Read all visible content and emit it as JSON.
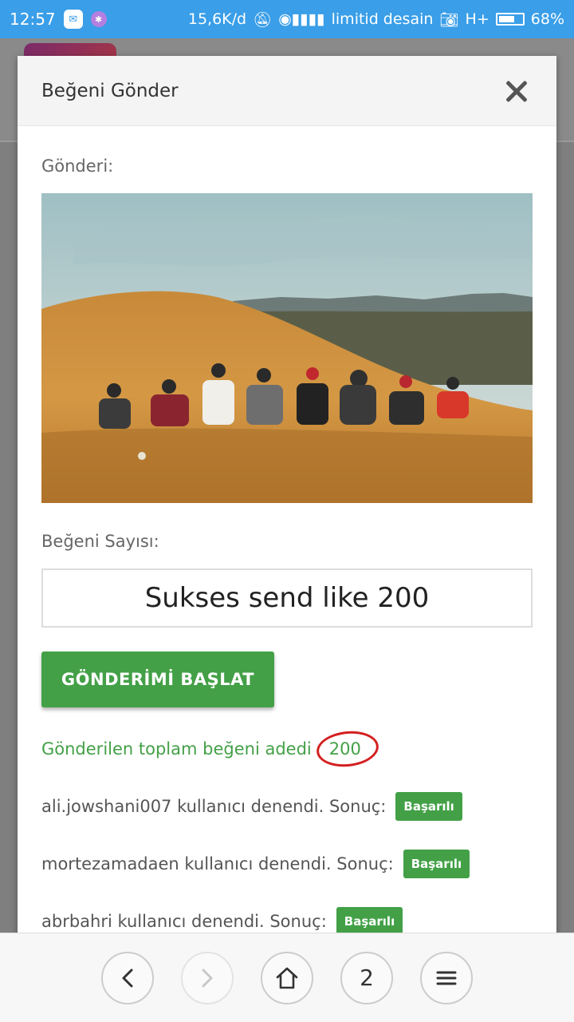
{
  "status_bar": {
    "time": "12:57",
    "speed": "15,6K/d",
    "carrier": "limitid desain",
    "network": "H+",
    "battery": "68%",
    "battery_level": 0.68
  },
  "modal": {
    "title": "Beğeni Gönder",
    "post_label": "Gönderi:",
    "like_count_label": "Beğeni Sayısı:",
    "like_input_value": "Sukses send like 200",
    "start_button": "GÖNDERİMİ BAŞLAT",
    "total_label": "Gönderilen toplam beğeni adedi",
    "total_count": "200",
    "results": [
      {
        "text": "ali.jowshani007 kullanıcı denendi. Sonuç:",
        "badge": "Başarılı"
      },
      {
        "text": "mortezamadaen kullanıcı denendi. Sonuç:",
        "badge": "Başarılı"
      },
      {
        "text": "abrbahri kullanıcı denendi. Sonuç:",
        "badge": "Başarılı"
      }
    ]
  },
  "nav": {
    "tab_count": "2"
  },
  "colors": {
    "accent_green": "#43a047",
    "status_blue": "#3a9ee8",
    "highlight_red": "#d42020"
  }
}
